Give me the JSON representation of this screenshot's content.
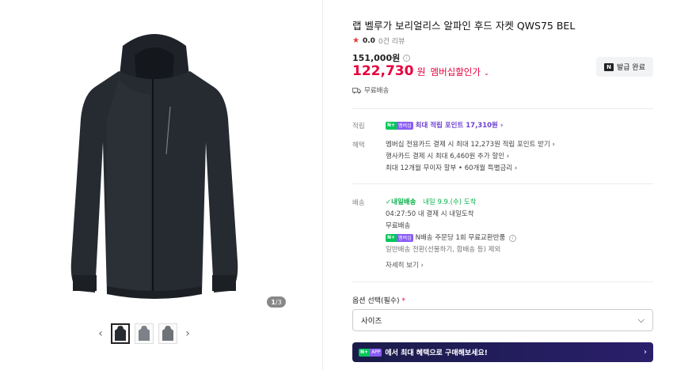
{
  "gallery": {
    "page_current": "1",
    "page_sep": "/",
    "page_total": "3",
    "prev_icon": "chevron-left-icon",
    "next_icon": "chevron-right-icon",
    "prev_glyph": "‹",
    "next_glyph": "›"
  },
  "product": {
    "title": "랩 벨루가 보리얼리스 알파인 후드 자켓 QWS75 BEL",
    "rating_star": "★",
    "rating": "0.0",
    "reviews": "0건 리뷰",
    "original_price": "151,000원",
    "sale_price": "122,730",
    "sale_currency": "원",
    "sale_label": "멤버십할인가",
    "sale_chevron": "⌄",
    "coupon_badge": "N",
    "coupon_label": "발급 완료",
    "free_shipping": "무료배송",
    "info_glyph": "i"
  },
  "benefits": {
    "points_label": "적립",
    "points_badge_n": "N+",
    "points_badge_text": "멤버십",
    "points_text": "최대 적립 포인트 17,310원 ›",
    "perks_label": "혜택",
    "perks": [
      "멤버십 전용카드 결제 시 최대 12,273원 적립 포인트 받기 ›",
      "행사카드 결제 시 최대 6,460원 추가 할인 ›",
      "최대 12개월 무이자 할부 • 60개월 특별금리 ›"
    ]
  },
  "delivery": {
    "label": "배송",
    "tomorrow_badge": "✓내일배송",
    "tomorrow_date": "내일 9.9.(수) 도착",
    "deadline": "04:27:50  내 결제 시 내일도착",
    "fee": "무료배송",
    "n_badge_n": "N+",
    "n_badge_text": "멤버십",
    "n_exchange": "N배송 주문당 1회 무료교환반품",
    "normal_switch": "일반배송 전환(선물하기, 합배송 등) 제외",
    "more": "자세히 보기 ›"
  },
  "options": {
    "label": "옵션 선택",
    "required": "(필수)",
    "required_mark": "*",
    "select_value": "사이즈",
    "select_chevron": "⌵"
  },
  "banner": {
    "badge_n": "N+",
    "badge_app": "APP",
    "text": "에서 최대 혜택으로 구매해보세요!",
    "arrow": "›"
  },
  "colors": {
    "accent_red": "#e6003d",
    "naver_green": "#03c75a",
    "membership_purple": "#6b3fd1"
  }
}
